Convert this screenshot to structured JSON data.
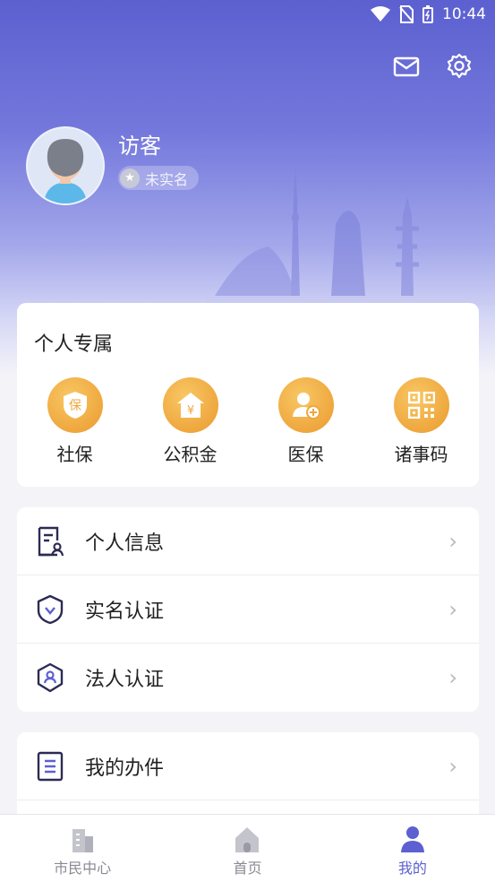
{
  "status_bar": {
    "time": "10:44"
  },
  "profile": {
    "name": "访客",
    "badge": "未实名"
  },
  "exclusive": {
    "title": "个人专属",
    "items": [
      {
        "label": "社保",
        "icon": "shield-bao-icon"
      },
      {
        "label": "公积金",
        "icon": "house-yen-icon"
      },
      {
        "label": "医保",
        "icon": "user-medical-icon"
      },
      {
        "label": "诸事码",
        "icon": "qr-code-icon"
      }
    ]
  },
  "menu": {
    "items": [
      {
        "label": "个人信息",
        "icon": "document-user-icon"
      },
      {
        "label": "实名认证",
        "icon": "shield-check-icon"
      },
      {
        "label": "法人认证",
        "icon": "shield-user-icon"
      }
    ],
    "items2": [
      {
        "label": "我的办件",
        "icon": "list-document-icon"
      }
    ]
  },
  "tabbar": {
    "tabs": [
      {
        "label": "市民中心",
        "icon": "building-icon"
      },
      {
        "label": "首页",
        "icon": "home-icon"
      },
      {
        "label": "我的",
        "icon": "user-icon"
      }
    ]
  },
  "colors": {
    "primary": "#5c60d0",
    "accent_orange": "#efa73e",
    "icon_navy": "#2b2b55"
  }
}
